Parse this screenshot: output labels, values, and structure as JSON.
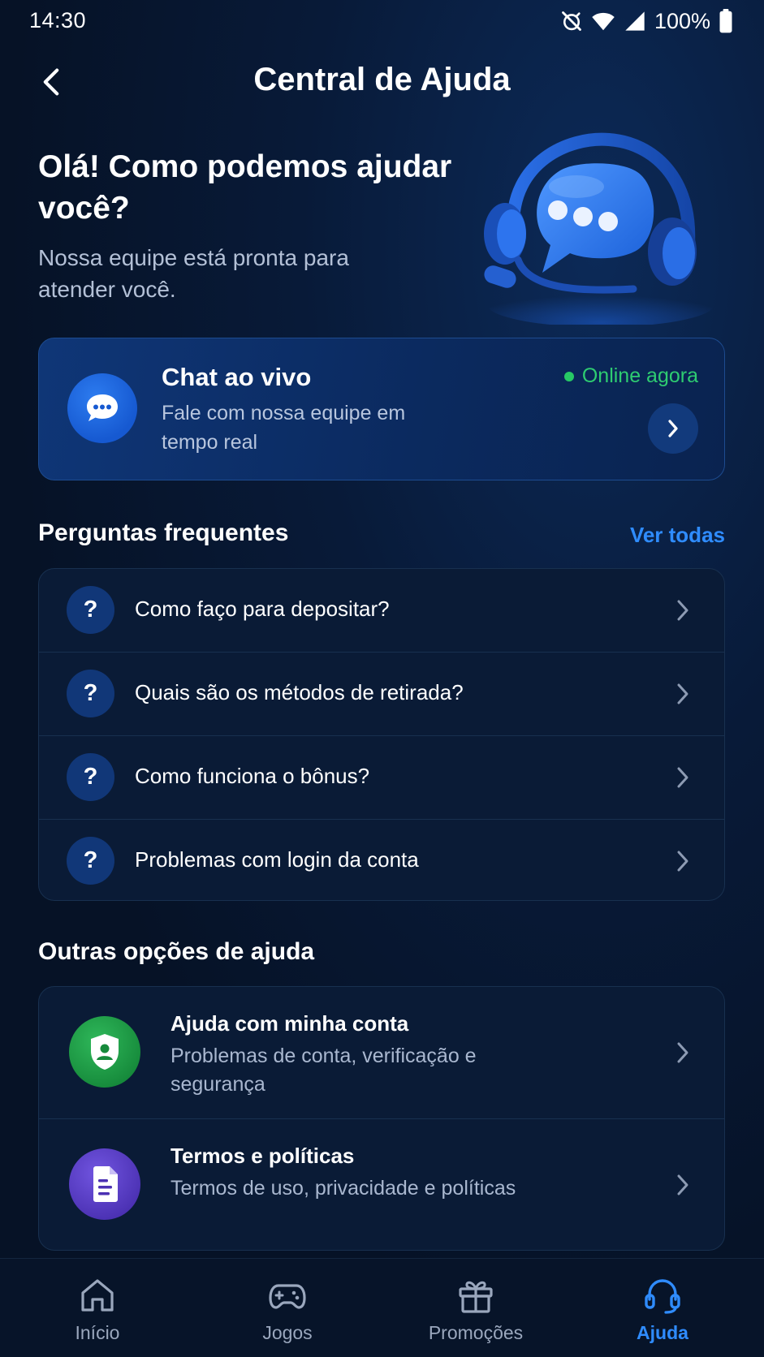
{
  "status_bar": {
    "time": "14:30",
    "battery": "100%",
    "icons": [
      "alarm-off-icon",
      "wifi-icon",
      "signal-icon",
      "battery-icon"
    ]
  },
  "header": {
    "title": "Central de Ajuda",
    "back_icon": "back-arrow-icon"
  },
  "hero": {
    "title": "Olá! Como podemos ajudar você?",
    "subtitle": "Nossa equipe está pronta para atender você.",
    "illustration": "headset-chat-bubble-icon"
  },
  "chat_card": {
    "title": "Chat ao vivo",
    "description": "Fale com nossa equipe em tempo real",
    "status": "Online agora",
    "status_color": "#2ecc71",
    "icon": "chat-bubble-icon"
  },
  "faq": {
    "title": "Perguntas frequentes",
    "see_all": "Ver todas",
    "items": [
      {
        "icon_text": "?",
        "label": "Como faço para depositar?"
      },
      {
        "icon_text": "?",
        "label": "Quais são os métodos de retirada?"
      },
      {
        "icon_text": "?",
        "label": "Como funciona o bônus?"
      },
      {
        "icon_text": "?",
        "label": "Problemas com login da conta"
      }
    ]
  },
  "other_options": {
    "title": "Outras opções de ajuda",
    "items": [
      {
        "title": "Ajuda com minha conta",
        "description": "Problemas de conta, verificação e segurança",
        "icon": "shield-user-icon",
        "color": "#1f9e4a"
      },
      {
        "title": "Termos e políticas",
        "description": "Termos de uso, privacidade e políticas",
        "icon": "document-icon",
        "color": "#5a3fcc"
      }
    ]
  },
  "bottom_nav": {
    "active": "Ajuda",
    "accent": "#2f8cff",
    "items": [
      {
        "label": "Início",
        "icon": "home-icon"
      },
      {
        "label": "Jogos",
        "icon": "gamepad-icon"
      },
      {
        "label": "Promoções",
        "icon": "gift-icon"
      },
      {
        "label": "Ajuda",
        "icon": "headset-icon"
      }
    ]
  }
}
